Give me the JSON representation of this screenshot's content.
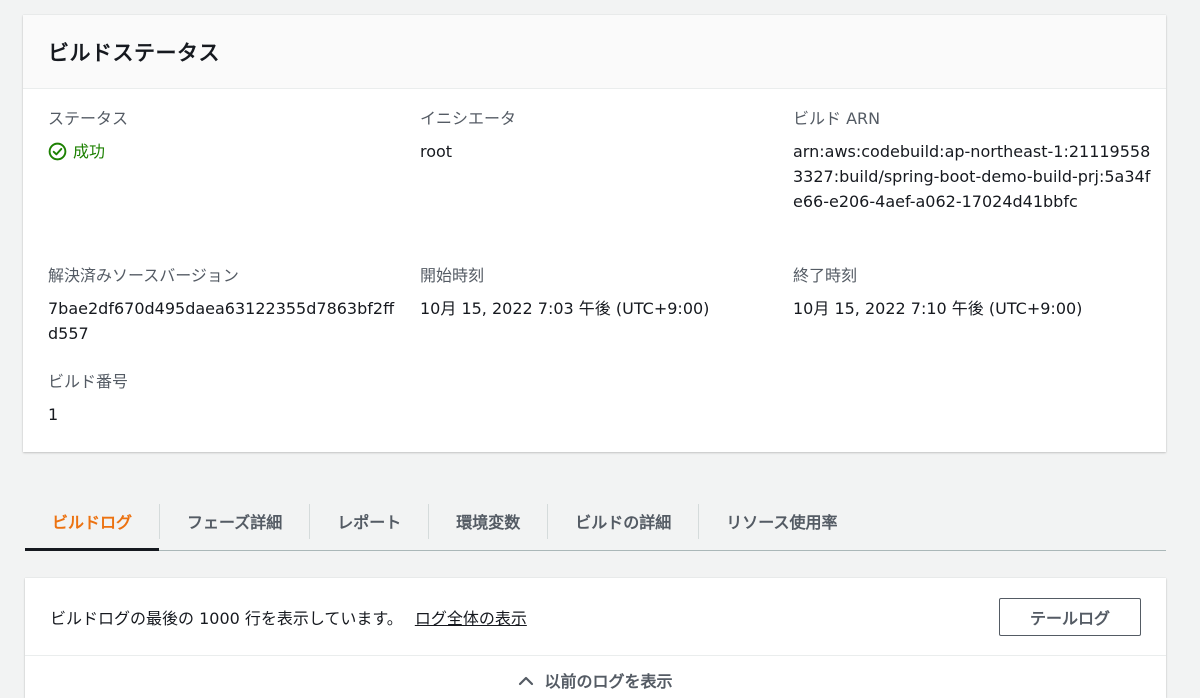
{
  "build_status": {
    "title": "ビルドステータス",
    "status": {
      "label": "ステータス",
      "value": "成功",
      "color": "#1d8102",
      "icon": "check-circle-icon"
    },
    "initiator": {
      "label": "イニシエータ",
      "value": "root"
    },
    "build_arn": {
      "label": "ビルド ARN",
      "value": "arn:aws:codebuild:ap-northeast-1:211195583327:build/spring-boot-demo-build-prj:5a34fe66-e206-4aef-a062-17024d41bbfc"
    },
    "resolved_source_version": {
      "label": "解決済みソースバージョン",
      "value": "7bae2df670d495daea63122355d7863bf2ffd557"
    },
    "start_time": {
      "label": "開始時刻",
      "value": "10月 15, 2022 7:03 午後 (UTC+9:00)"
    },
    "end_time": {
      "label": "終了時刻",
      "value": "10月 15, 2022 7:10 午後 (UTC+9:00)"
    },
    "build_number": {
      "label": "ビルド番号",
      "value": "1"
    }
  },
  "tabs": [
    {
      "label": "ビルドログ",
      "active": true
    },
    {
      "label": "フェーズ詳細",
      "active": false
    },
    {
      "label": "レポート",
      "active": false
    },
    {
      "label": "環境変数",
      "active": false
    },
    {
      "label": "ビルドの詳細",
      "active": false
    },
    {
      "label": "リソース使用率",
      "active": false
    }
  ],
  "log_panel": {
    "message": "ビルドログの最後の 1000 行を表示しています。",
    "full_log_link": "ログ全体の表示",
    "tail_button": "テールログ",
    "show_previous": "以前のログを表示",
    "show_previous_icon": "chevron-up-icon"
  },
  "colors": {
    "accent": "#ec7211",
    "success": "#1d8102"
  }
}
